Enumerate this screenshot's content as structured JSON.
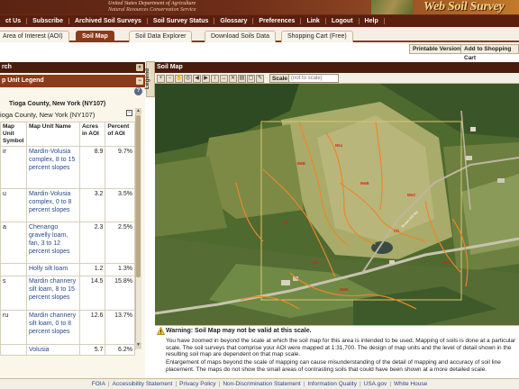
{
  "header": {
    "agency_line1": "United States Department of Agriculture",
    "agency_line2": "Natural Resources Conservation Service",
    "logo": "Web Soil Survey"
  },
  "nav": [
    "ct Us",
    "Subscribe",
    "Archived Soil Surveys",
    "Soil Survey Status",
    "Glossary",
    "Preferences",
    "Link",
    "Logout",
    "Help"
  ],
  "tabs": [
    {
      "label": "Area of Interest (AOI)",
      "active": false
    },
    {
      "label": "Soil Map",
      "active": true
    },
    {
      "label": "Soil Data Explorer",
      "active": false
    },
    {
      "label": "Download Soils Data",
      "active": false
    },
    {
      "label": "Shopping Cart (Free)",
      "active": false
    }
  ],
  "subbar": {
    "printable": "Printable Version",
    "add_cart": "Add to Shopping Cart"
  },
  "left": {
    "search_header": "rch",
    "legend_header": "p Unit Legend",
    "ctl_collapse": "«",
    "ctl_minus": "−",
    "help": "?",
    "area_line1": "Tioga County, New York (NY107)",
    "area_line2": "ioga County, New York (NY107)",
    "collapse_box": "−",
    "scroll_up": "▲",
    "scroll_down": "▼",
    "columns": [
      "Map Unit Symbol",
      "Map Unit Name",
      "Acres in AOI",
      "Percent of AOI"
    ],
    "rows": [
      {
        "symbol": "ir",
        "name": "Mardin-Volusia complex, 8 to 15 percent slopes",
        "acres": "8.9",
        "pct": "9.7%"
      },
      {
        "symbol": "u",
        "name": "Mardin-Volusia complex, 0 to 8 percent slopes",
        "acres": "3.2",
        "pct": "3.5%"
      },
      {
        "symbol": "a",
        "name": "Chenango gravelly loam, fan, 3 to 12 percent slopes",
        "acres": "2.3",
        "pct": "2.5%"
      },
      {
        "symbol": "",
        "name": "Holly silt loam",
        "acres": "1.2",
        "pct": "1.3%"
      },
      {
        "symbol": "s",
        "name": "Mardin channery silt loam, 8 to 15 percent slopes",
        "acres": "14.5",
        "pct": "15.8%"
      },
      {
        "symbol": "ru",
        "name": "Mardin channery silt loam, 0 to 8 percent slopes",
        "acres": "12.6",
        "pct": "13.7%"
      },
      {
        "symbol": "",
        "name": "Volusia",
        "acres": "5.7",
        "pct": "6.2%"
      }
    ]
  },
  "legend_tab": "Legend",
  "map": {
    "title": "Soil Map",
    "scale_label": "Scale",
    "scale_value": "(not to scale)",
    "tools": [
      "zoom-in-icon",
      "zoom-out-icon",
      "pan-icon",
      "full-extent-icon",
      "back-icon",
      "forward-icon",
      "identify-icon",
      "measure-icon",
      "clear-icon",
      "print-icon",
      "aoi-icon",
      "draw-icon",
      "edit-icon"
    ],
    "unit_labels": [
      "Mra",
      "MrB",
      "MsB",
      "Vo",
      "MsC",
      "Ch",
      "Ho",
      "MsD",
      "Mrb"
    ],
    "road_label": "Brown Hill Rd"
  },
  "warning": {
    "title": "Warning: Soil Map may not be valid at this scale.",
    "p1": "You have zoomed in beyond the scale at which the soil map for this area is intended to be used. Mapping of soils is done at a particular scale. The soil surveys that comprise your AOI were mapped at 1:31,700. The design of map units and the level of detail shown in the resulting soil map are dependent on that map scale.",
    "p2": "Enlargement of maps beyond the scale of mapping can cause misunderstanding of the detail of mapping and accuracy of soil line placement. The maps do not show the small areas of contrasting soils that could have been shown at a more detailed scale."
  },
  "footer": [
    "FOIA",
    "Accessibility Statement",
    "Privacy Policy",
    "Non-Discrimination Statement",
    "Information Quality",
    "USA.gov",
    "White House"
  ],
  "colors": {
    "brand": "#8b3a1a",
    "dark": "#4a1c0e",
    "soil_line": "#e8882a",
    "aoi": "#d8c870"
  }
}
